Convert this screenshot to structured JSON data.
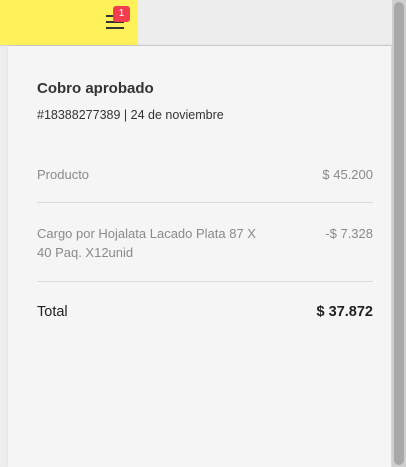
{
  "header": {
    "menu_icon": "hamburger-menu-icon",
    "notification_count": "1",
    "brand_color": "#fff159",
    "badge_color": "#f23d4f"
  },
  "payment": {
    "title": "Cobro aprobado",
    "meta": "#18388277389 | 24 de noviembre"
  },
  "lines": [
    {
      "label": "Producto",
      "amount": "$ 45.200"
    },
    {
      "label": "Cargo por Hojalata Lacado Plata 87 X 40 Paq. X12unid",
      "amount": "-$ 7.328"
    }
  ],
  "total": {
    "label": "Total",
    "amount": "$ 37.872"
  }
}
